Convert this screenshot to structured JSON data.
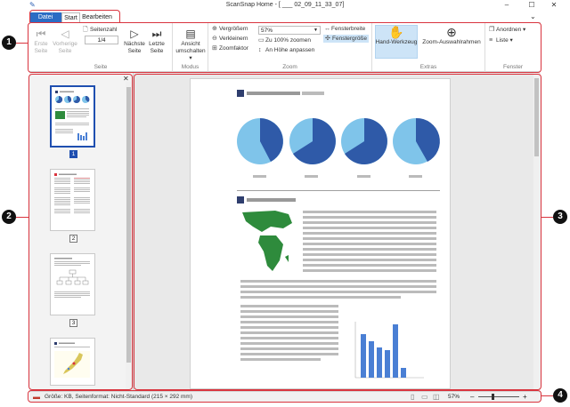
{
  "window": {
    "title": "ScanSnap Home - [ ___ 02_09_11_33_07]",
    "minimize": "–",
    "maximize": "☐",
    "close": "✕"
  },
  "tabs": [
    {
      "label": "Datei"
    },
    {
      "label": "Start"
    },
    {
      "label": "Bearbeiten"
    }
  ],
  "ribbon": {
    "seite": {
      "label": "Seite",
      "first": "Erste Seite",
      "prev": "Vorherige Seite",
      "page_label": "Seitenzahl",
      "page_value": "1/4",
      "next": "Nächste Seite",
      "last": "Letzte Seite"
    },
    "modus": {
      "label": "Modus",
      "view": "Ansicht umschalten"
    },
    "zoom": {
      "label": "Zoom",
      "zoom_in": "Vergrößern",
      "zoom_out": "Verkleinern",
      "zoom_factor": "Zoomfaktor",
      "zoom_value": "57%",
      "zoom_100": "Zu 100% zoomen",
      "fit_height": "An Höhe anpassen",
      "window_width": "Fensterbreite",
      "window_size": "Fenstergröße"
    },
    "extras": {
      "label": "Extras",
      "hand": "Hand-Werkzeug",
      "zoom_select": "Zoom-Auswahlrahmen"
    },
    "fenster": {
      "label": "Fenster",
      "arrange": "Anordnen",
      "list": "Liste"
    }
  },
  "thumbnails": [
    {
      "num": "1"
    },
    {
      "num": "2"
    },
    {
      "num": "3"
    },
    {
      "num": "4"
    }
  ],
  "status": {
    "text": "Größe:        KB, Seitenformat: Nicht-Standard (215 × 292 mm)",
    "zoom": "57%",
    "minus": "–",
    "plus": "+"
  },
  "callouts": [
    "1",
    "2",
    "3",
    "4"
  ],
  "colors": {
    "accent": "#2b6cc4",
    "annotation": "#d9343e",
    "pie_dark": "#2f5aa8",
    "pie_light": "#7fc4ea",
    "bar": "#4a7fd4",
    "map_green": "#2e8b3c"
  }
}
